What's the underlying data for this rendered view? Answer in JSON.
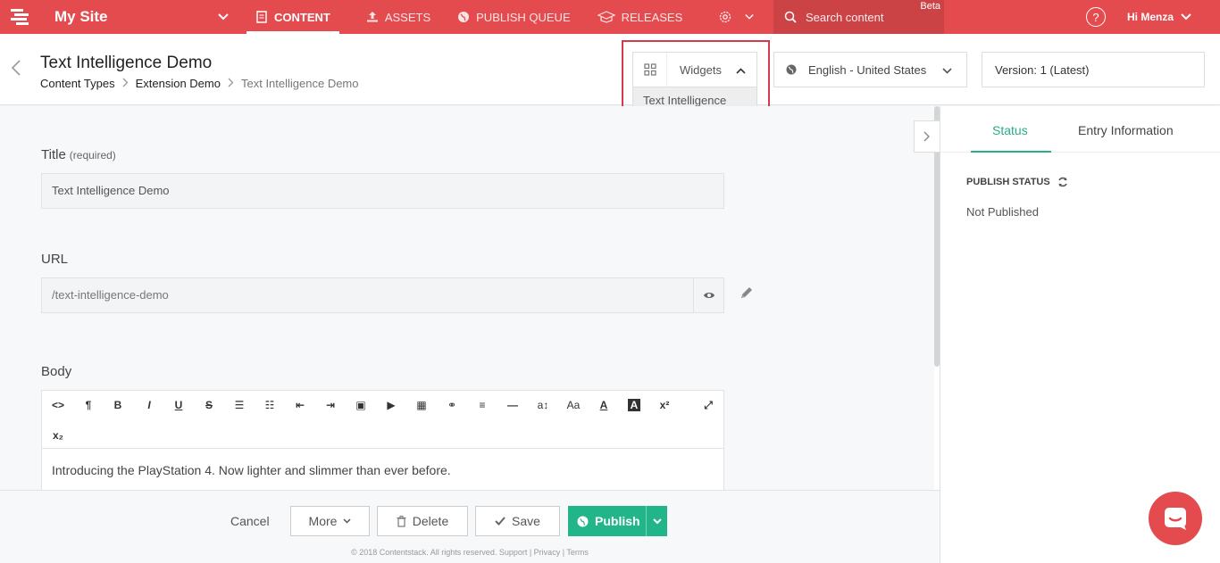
{
  "topnav": {
    "site_name": "My Site",
    "tabs": [
      {
        "label": "CONTENT",
        "icon": "document-icon",
        "active": true
      },
      {
        "label": "ASSETS",
        "icon": "upload-icon",
        "active": false
      },
      {
        "label": "PUBLISH QUEUE",
        "icon": "globe-icon",
        "active": false
      },
      {
        "label": "RELEASES",
        "icon": "box-icon",
        "active": false
      }
    ],
    "search_placeholder": "Search content",
    "beta": "Beta",
    "help": "?",
    "user": "Hi  Menza",
    "accent": "#e44b4f"
  },
  "header": {
    "title": "Text Intelligence Demo",
    "breadcrumbs": [
      "Content Types",
      "Extension Demo",
      "Text Intelligence Demo"
    ],
    "widgets_label": "Widgets",
    "widgets_menu_item": "Text Intelligence",
    "locale": "English - United States",
    "version": "Version: 1 (Latest)"
  },
  "form": {
    "title_label": "Title",
    "required": "(required)",
    "title_value": "Text Intelligence Demo",
    "url_label": "URL",
    "url_value": "/text-intelligence-demo",
    "body_label": "Body",
    "body_text": "Introducing the PlayStation 4. Now lighter and slimmer than ever before."
  },
  "footer": {
    "cancel": "Cancel",
    "more": "More",
    "delete": "Delete",
    "save": "Save",
    "publish": "Publish",
    "copyright": "© 2018 Contentstack. All rights reserved. Support | Privacy | Terms"
  },
  "rpanel": {
    "tab_status": "Status",
    "tab_entry": "Entry Information",
    "publish_status_title": "PUBLISH STATUS",
    "publish_status_value": "Not Published",
    "accent": "#2dab88"
  }
}
